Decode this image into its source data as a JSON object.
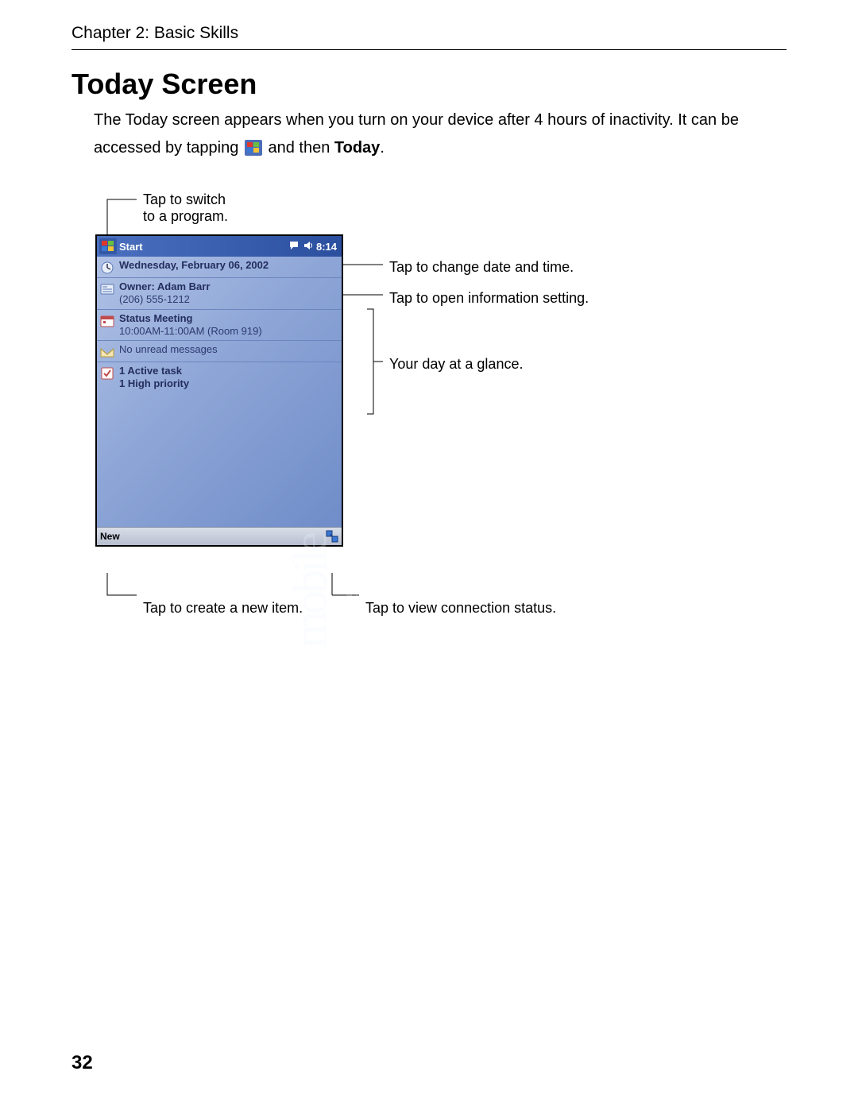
{
  "header": {
    "chapter": "Chapter 2: Basic Skills"
  },
  "section": {
    "title": "Today Screen"
  },
  "body": {
    "p1a": "The Today screen appears when you turn on your device after 4 hours of inactivity. It can be",
    "p2a": "accessed by tapping ",
    "p2b": " and then ",
    "p2c": "Today",
    "p2d": "."
  },
  "device": {
    "topbar": {
      "start": "Start",
      "time": "8:14"
    },
    "items": {
      "date": "Wednesday, February 06, 2002",
      "owner_label": "Owner: Adam Barr",
      "owner_phone": "(206) 555-1212",
      "meeting_title": "Status Meeting",
      "meeting_detail": "10:00AM-11:00AM (Room 919)",
      "inbox": "No unread messages",
      "tasks_active": "1 Active task",
      "tasks_priority": "1 High priority"
    },
    "bottombar": {
      "new": "New"
    }
  },
  "callouts": {
    "switch_program_1": "Tap to switch",
    "switch_program_2": "to a program.",
    "change_date": "Tap to change date and time.",
    "open_info": "Tap to open information setting.",
    "day_glance": "Your day at a glance.",
    "create_new": "Tap to create a new item.",
    "view_conn": "Tap to view connection status."
  },
  "page_number": "32"
}
